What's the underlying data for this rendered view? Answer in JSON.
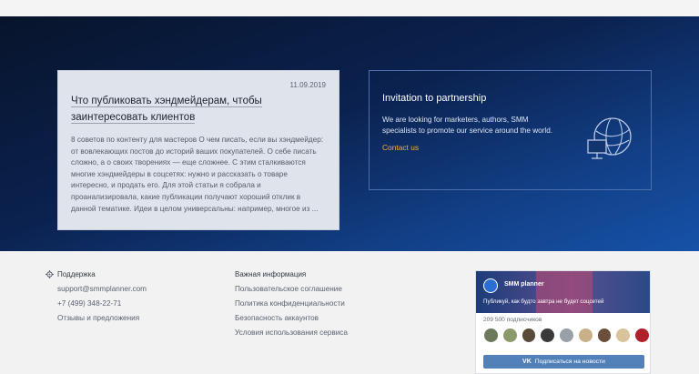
{
  "article": {
    "date": "11.09.2019",
    "title": "Что публиковать хэндмейдерам, чтобы заинтересовать клиентов",
    "excerpt": "8 советов по контенту для мастеров О чем писать, если вы хэндмейдер: от вовлекающих постов до историй ваших покупателей. О себе писать сложно, а о своих творениях — еще сложнее. С этим сталкиваются многие хэндмейдеры в соцсетях: нужно и рассказать о товаре интересно, и продать его. Для этой статьи я собрала и проанализировала, какие публикации получают хороший отклик в данной тематике. Идеи в целом универсальны: например, многое из ..."
  },
  "partnership": {
    "title": "Invitation to partnership",
    "text": "We are looking for marketers, authors, SMM specialists to promote our service around the world.",
    "link": "Contact us",
    "icon": "globe-monitor-icon"
  },
  "footer": {
    "support": {
      "heading": "Поддержка",
      "icon": "gear-icon",
      "items": [
        "support@smmplanner.com",
        "+7 (499) 348-22-71",
        "Отзывы и предложения"
      ]
    },
    "info": {
      "heading": "Важная информация",
      "items": [
        "Пользовательское соглашение",
        "Политика конфиденциальности",
        "Безопасность аккаунтов",
        "Условия использования сервиса"
      ]
    }
  },
  "vk_widget": {
    "name": "SMM planner",
    "description": "Публикуй, как будто завтра не будет соцсетей",
    "subscribers": "209 500 подписчиков",
    "button": "Подписаться на новости",
    "avatar_colors": [
      "#6b7a5a",
      "#8a9a6a",
      "#5a4a3a",
      "#3a3a3a",
      "#9aa0a8",
      "#c9b089",
      "#6b4f3a",
      "#d9c39a",
      "#b0202a"
    ]
  },
  "colors": {
    "accent": "#f3b233",
    "vk_button": "#5181b8"
  }
}
